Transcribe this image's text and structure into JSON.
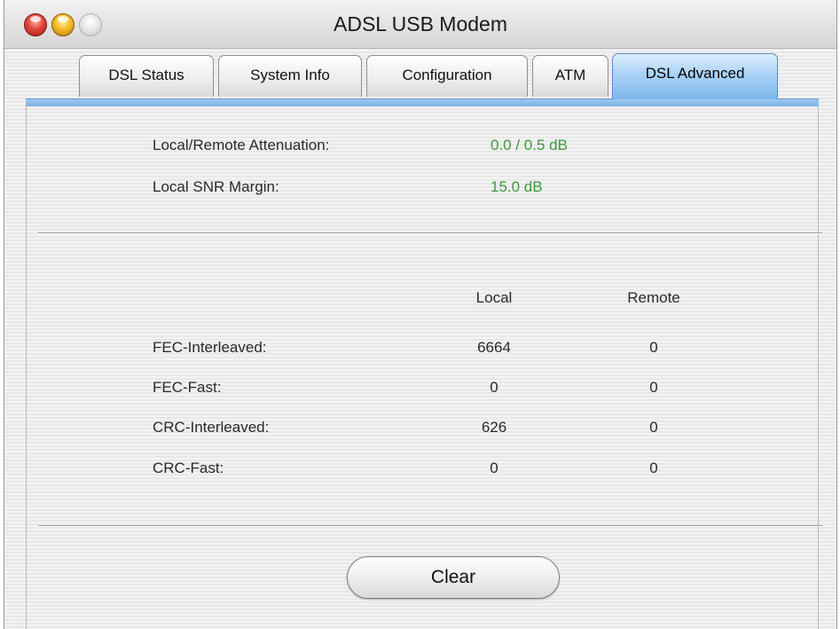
{
  "window": {
    "title": "ADSL USB Modem"
  },
  "tabs": [
    {
      "label": "DSL Status"
    },
    {
      "label": "System Info"
    },
    {
      "label": "Configuration"
    },
    {
      "label": "ATM"
    },
    {
      "label": "DSL Advanced",
      "active": true
    }
  ],
  "summary": {
    "attenuation_label": "Local/Remote Attenuation:",
    "attenuation_value": "0.0 / 0.5 dB",
    "snr_label": "Local SNR Margin:",
    "snr_value": "15.0 dB",
    "value_color": "#3c9a3c"
  },
  "errors": {
    "headers": {
      "local": "Local",
      "remote": "Remote"
    },
    "rows": [
      {
        "label": "FEC-Interleaved:",
        "local": "6664",
        "remote": "0"
      },
      {
        "label": "FEC-Fast:",
        "local": "0",
        "remote": "0"
      },
      {
        "label": "CRC-Interleaved:",
        "local": "626",
        "remote": "0"
      },
      {
        "label": "CRC-Fast:",
        "local": "0",
        "remote": "0"
      }
    ]
  },
  "actions": {
    "clear_label": "Clear"
  },
  "colors": {
    "active_tab": "#a9d2f6",
    "close": "#e0443a",
    "minimize": "#f5b928"
  },
  "icons": {
    "close": "close-icon",
    "minimize": "minimize-icon",
    "zoom": "zoom-icon"
  }
}
